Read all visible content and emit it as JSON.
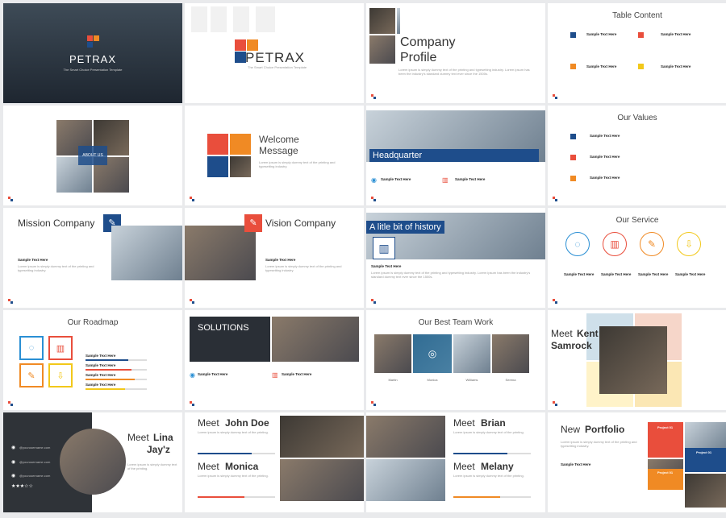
{
  "brand": {
    "title": "PETRAX",
    "tagline": "The Smart Choice Presentation Template"
  },
  "slides": {
    "company": {
      "title1": "Company",
      "title2": "Profile"
    },
    "toc": {
      "title": "Table Content",
      "items": [
        "Sample Text Here",
        "Sample Text Here",
        "Sample Text Here",
        "Sample Text Here"
      ]
    },
    "about": {
      "label": "ABOUT US"
    },
    "welcome": {
      "title1": "Welcome",
      "title2": "Message"
    },
    "hq": {
      "title": "Headquarter",
      "items": [
        "Sample Text Here",
        "Sample Text Here"
      ]
    },
    "values": {
      "title": "Our Values",
      "items": [
        "Sample Text Here",
        "Sample Text Here",
        "Sample Text Here"
      ]
    },
    "mission": {
      "title": "Mission Company",
      "label": "Sample Text Here"
    },
    "vision": {
      "title": "Vision Company",
      "label": "Sample Text Here"
    },
    "history": {
      "title": "A litle bit of history",
      "label": "Sample Text Here"
    },
    "service": {
      "title": "Our Service",
      "items": [
        "Sample Text Here",
        "Sample Text Here",
        "Sample Text Here",
        "Sample Text Here"
      ]
    },
    "roadmap": {
      "title": "Our Roadmap",
      "items": [
        "Sample Text Here",
        "Sample Text Here",
        "Sample Text Here",
        "Sample Text Here"
      ]
    },
    "solutions": {
      "title": "SOLUTIONS",
      "items": [
        "Sample Text Here",
        "Sample Text Here"
      ]
    },
    "team": {
      "title": "Our Best Team Work",
      "names": [
        "Martin",
        "Monica",
        "Williams",
        "Serena"
      ]
    },
    "kent": {
      "meet": "Meet",
      "name1": "Kent",
      "name2": "Samrock"
    },
    "lina": {
      "meet": "Meet",
      "name1": "Lina",
      "name2": "Jay'z",
      "contacts": [
        "@yourusername.com",
        "@yourusername.com",
        "@yourusername.com"
      ]
    },
    "john": {
      "meet": "Meet",
      "name": "John Doe"
    },
    "monica": {
      "meet": "Meet",
      "name": "Monica"
    },
    "brian": {
      "meet": "Meet",
      "name": "Brian"
    },
    "melany": {
      "meet": "Meet",
      "name": "Melany"
    },
    "portfolio": {
      "title1": "New",
      "title2": "Portfolio",
      "label": "Sample Text Here",
      "projects": [
        "Project 01",
        "Project 01",
        "Project 01"
      ]
    }
  },
  "colors": {
    "navy": "#1e4d8b",
    "red": "#e94e3c",
    "orange": "#f08a24",
    "yellow": "#f2c81a",
    "blue": "#2a8fd4"
  }
}
